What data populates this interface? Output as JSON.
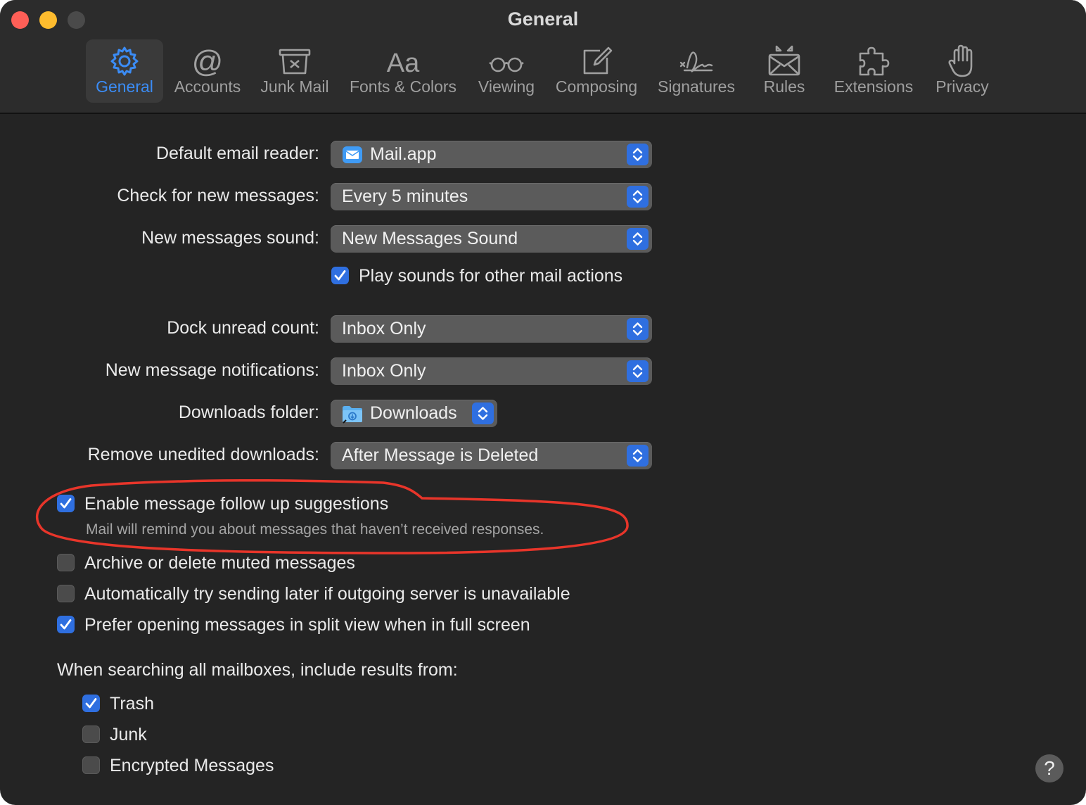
{
  "window": {
    "title": "General"
  },
  "toolbar": {
    "tabs": [
      {
        "label": "General",
        "icon": "gear-icon",
        "active": true
      },
      {
        "label": "Accounts",
        "icon": "at-sign-icon"
      },
      {
        "label": "Junk Mail",
        "icon": "junk-tray-icon"
      },
      {
        "label": "Fonts & Colors",
        "icon": "font-aa-icon"
      },
      {
        "label": "Viewing",
        "icon": "glasses-icon"
      },
      {
        "label": "Composing",
        "icon": "compose-pencil-icon"
      },
      {
        "label": "Signatures",
        "icon": "signature-icon"
      },
      {
        "label": "Rules",
        "icon": "envelope-rules-icon"
      },
      {
        "label": "Extensions",
        "icon": "puzzle-piece-icon"
      },
      {
        "label": "Privacy",
        "icon": "hand-icon"
      }
    ]
  },
  "settings": {
    "default_reader": {
      "label": "Default email reader:",
      "value": "Mail.app",
      "icon": "mail-app-icon"
    },
    "check_new": {
      "label": "Check for new messages:",
      "value": "Every 5 minutes"
    },
    "sound": {
      "label": "New messages sound:",
      "value": "New Messages Sound"
    },
    "play_sounds": {
      "label": "Play sounds for other mail actions",
      "checked": true
    },
    "dock_unread": {
      "label": "Dock unread count:",
      "value": "Inbox Only"
    },
    "notifications": {
      "label": "New message notifications:",
      "value": "Inbox Only"
    },
    "downloads_folder": {
      "label": "Downloads folder:",
      "value": "Downloads",
      "icon": "downloads-folder-icon"
    },
    "remove_downloads": {
      "label": "Remove unedited downloads:",
      "value": "After Message is Deleted"
    },
    "follow_up": {
      "label": "Enable message follow up suggestions",
      "description": "Mail will remind you about messages that haven’t received responses.",
      "checked": true
    },
    "archive_muted": {
      "label": "Archive or delete muted messages",
      "checked": false
    },
    "auto_send_later": {
      "label": "Automatically try sending later if outgoing server is unavailable",
      "checked": false
    },
    "split_view": {
      "label": "Prefer opening messages in split view when in full screen",
      "checked": true
    },
    "search_heading": "When searching all mailboxes, include results from:",
    "search_trash": {
      "label": "Trash",
      "checked": true
    },
    "search_junk": {
      "label": "Junk",
      "checked": false
    },
    "search_encrypted": {
      "label": "Encrypted Messages",
      "checked": false
    }
  },
  "help": {
    "label": "?"
  },
  "colors": {
    "accent": "#3b8cf5",
    "checkbox_on": "#2f6fe0",
    "annotation": "#e8352a",
    "background": "#242424"
  }
}
